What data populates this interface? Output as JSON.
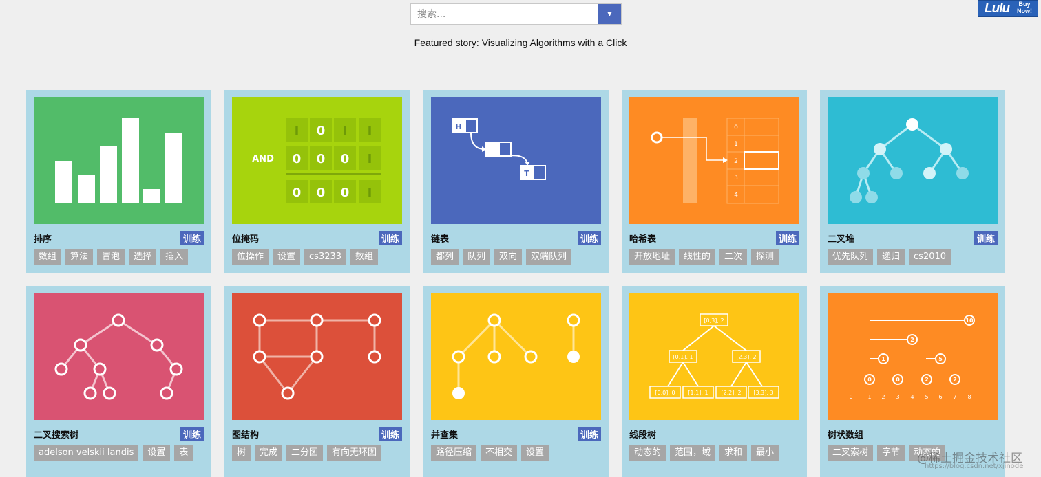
{
  "search": {
    "placeholder": "搜索...",
    "dropdown_icon": "caret-down-icon"
  },
  "featured": {
    "prefix": "Featured story: ",
    "link": "Visualizing Algorithms with a Click"
  },
  "ad": {
    "brand": "Lulu",
    "cta_line1": "Buy",
    "cta_line2": "Now!",
    "color": "#2a62b8"
  },
  "train_label": "训练",
  "colors": {
    "card_bg": "#add8e6",
    "train": "#4b68bc",
    "tag": "#a6a6a6"
  },
  "cards": [
    {
      "title": "排序",
      "train": true,
      "color": "#52bc69",
      "tags": [
        "数组",
        "算法",
        "冒泡",
        "选择",
        "插入"
      ]
    },
    {
      "title": "位掩码",
      "train": true,
      "color": "#a7d40d",
      "tags": [
        "位操作",
        "设置",
        "cs3233",
        "数组"
      ],
      "art": {
        "op": "AND",
        "row1": [
          "I",
          "0",
          "I",
          "I"
        ],
        "row2": [
          "0",
          "0",
          "0",
          "I"
        ],
        "row3": [
          "0",
          "0",
          "0",
          "I"
        ]
      }
    },
    {
      "title": "链表",
      "train": true,
      "color": "#4b68bc",
      "tags": [
        "都列",
        "队列",
        "双向",
        "双端队列"
      ],
      "art": {
        "head": "H",
        "tail": "T"
      }
    },
    {
      "title": "哈希表",
      "train": true,
      "color": "#fe8b23",
      "tags": [
        "开放地址",
        "线性的",
        "二次",
        "探测"
      ],
      "art": {
        "indices": [
          "0",
          "1",
          "2",
          "3",
          "4"
        ]
      }
    },
    {
      "title": "二叉堆",
      "train": true,
      "color": "#2ebcd3",
      "tags": [
        "优先队列",
        "递归",
        "cs2010"
      ]
    },
    {
      "title": "二叉搜索树",
      "train": true,
      "color": "#d95372",
      "tags": [
        "adelson velskii landis",
        "设置",
        "表"
      ]
    },
    {
      "title": "图结构",
      "train": true,
      "color": "#dc503a",
      "tags": [
        "树",
        "完成",
        "二分图",
        "有向无环图"
      ]
    },
    {
      "title": "并查集",
      "train": true,
      "color": "#fec515",
      "tags": [
        "路径压缩",
        "不相交",
        "设置"
      ]
    },
    {
      "title": "线段树",
      "train": false,
      "color": "#fec515",
      "tags": [
        "动态的",
        "范围，域",
        "求和",
        "最小"
      ],
      "art": {
        "nodes": [
          "[0,3], 2",
          "[0,1], 1",
          "[2,3], 2",
          "[0,0], 0",
          "[1,1], 1",
          "[2,2], 2",
          "[3,3], 3"
        ]
      }
    },
    {
      "title": "树状数组",
      "train": false,
      "color": "#fe8b23",
      "tags": [
        "二叉索树",
        "字节",
        "动态的"
      ],
      "art": {
        "values": [
          "10",
          "2",
          "1",
          "5",
          "0",
          "0",
          "2",
          "2"
        ],
        "axis": [
          "0",
          "1",
          "2",
          "3",
          "4",
          "5",
          "6",
          "7",
          "8"
        ]
      }
    }
  ],
  "watermark": {
    "line1": "@稀土掘金技术社区",
    "line2": "https://blog.csdn.net/xjinode"
  }
}
